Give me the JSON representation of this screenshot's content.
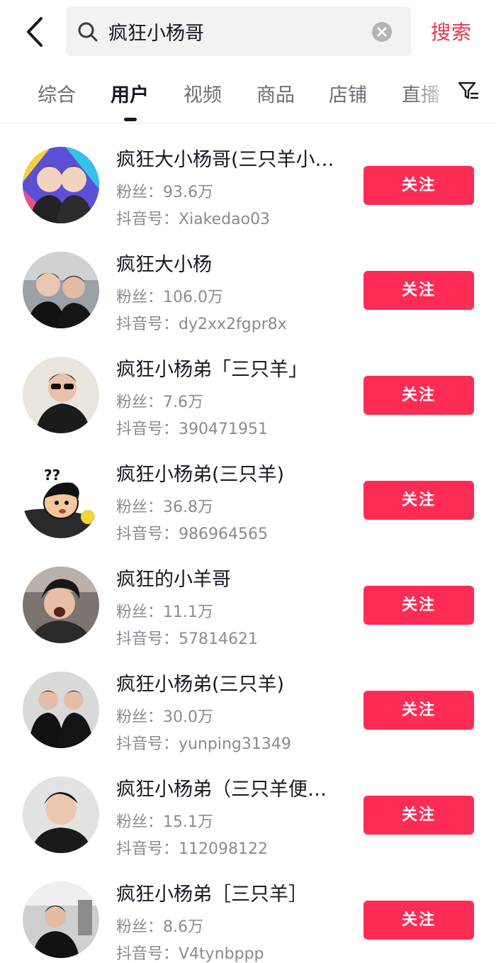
{
  "search": {
    "query": "疯狂小杨哥",
    "button_label": "搜索"
  },
  "tabs": [
    {
      "label": "综合"
    },
    {
      "label": "用户"
    },
    {
      "label": "视频"
    },
    {
      "label": "商品"
    },
    {
      "label": "店铺"
    },
    {
      "label": "直播"
    }
  ],
  "active_tab": "用户",
  "users": [
    {
      "name": "疯狂大小杨哥(三只羊小…",
      "fans": "粉丝：93.6万",
      "douyin_id": "抖音号：Xiakedao03",
      "follow_label": "关注"
    },
    {
      "name": "疯狂大小杨",
      "fans": "粉丝：106.0万",
      "douyin_id": "抖音号：dy2xx2fgpr8x",
      "follow_label": "关注"
    },
    {
      "name": "疯狂小杨弟「三只羊」",
      "fans": "粉丝：7.6万",
      "douyin_id": "抖音号：390471951",
      "follow_label": "关注"
    },
    {
      "name": "疯狂小杨弟(三只羊)",
      "fans": "粉丝：36.8万",
      "douyin_id": "抖音号：986964565",
      "follow_label": "关注"
    },
    {
      "name": "疯狂的小羊哥",
      "fans": "粉丝：11.1万",
      "douyin_id": "抖音号：57814621",
      "follow_label": "关注"
    },
    {
      "name": "疯狂小杨弟(三只羊)",
      "fans": "粉丝：30.0万",
      "douyin_id": "抖音号：yunping31349",
      "follow_label": "关注"
    },
    {
      "name": "疯狂小杨弟（三只羊便…",
      "fans": "粉丝：15.1万",
      "douyin_id": "抖音号：112098122",
      "follow_label": "关注"
    },
    {
      "name": "疯狂小杨弟［三只羊］",
      "fans": "粉丝：8.6万",
      "douyin_id": "抖音号：V4tynbppp",
      "follow_label": "关注"
    }
  ],
  "colors": {
    "follow_button": "#fe2c55",
    "search_button_text": "#e8354e",
    "search_box_bg": "#f2f2f4"
  },
  "icons": {
    "back": "back-arrow-icon",
    "search": "search-icon",
    "clear": "clear-icon",
    "filter": "filter-icon"
  }
}
